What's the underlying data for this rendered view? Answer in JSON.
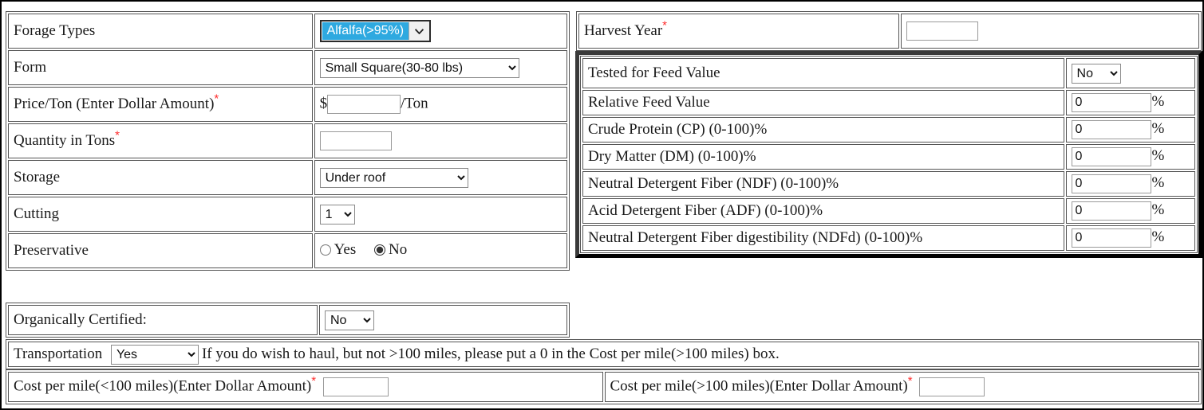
{
  "left_form": {
    "rows": [
      {
        "label": "Forage Types",
        "required": false,
        "control": "select-focused",
        "value": "Alfalfa(>95%)",
        "name": "forage-types"
      },
      {
        "label": "Form",
        "required": false,
        "control": "select",
        "value": "Small Square(30-80 lbs)",
        "name": "form"
      },
      {
        "label": "Price/Ton (Enter Dollar Amount)",
        "required": true,
        "control": "money",
        "prefix": "$",
        "suffix": "/Ton",
        "value": "",
        "name": "price-per-ton"
      },
      {
        "label": "Quantity in Tons",
        "required": true,
        "control": "text",
        "value": "",
        "name": "quantity-in-tons"
      },
      {
        "label": "Storage",
        "required": false,
        "control": "select",
        "value": "Under roof",
        "name": "storage"
      },
      {
        "label": "Cutting",
        "required": false,
        "control": "select",
        "value": "1",
        "name": "cutting"
      },
      {
        "label": "Preservative",
        "required": false,
        "control": "radio",
        "options": [
          "Yes",
          "No"
        ],
        "value": "No",
        "name": "preservative"
      }
    ]
  },
  "organic": {
    "label": "Organically Certified:",
    "value": "No",
    "name": "organically-certified"
  },
  "harvest": {
    "label": "Harvest Year",
    "required": true,
    "value": "",
    "name": "harvest-year"
  },
  "feed_panel": {
    "tested": {
      "label": "Tested for Feed Value",
      "value": "No",
      "name": "tested-for-feed-value"
    },
    "rows": [
      {
        "label": "Relative Feed Value",
        "value": "0",
        "unit": "%",
        "name": "relative-feed-value"
      },
      {
        "label": "Crude Protein (CP) (0-100)%",
        "value": "0",
        "unit": "%",
        "name": "crude-protein"
      },
      {
        "label": "Dry Matter (DM) (0-100)%",
        "value": "0",
        "unit": "%",
        "name": "dry-matter"
      },
      {
        "label": "Neutral Detergent Fiber (NDF) (0-100)%",
        "value": "0",
        "unit": "%",
        "name": "ndf"
      },
      {
        "label": "Acid Detergent Fiber (ADF) (0-100)%",
        "value": "0",
        "unit": "%",
        "name": "adf"
      },
      {
        "label": "Neutral Detergent Fiber digestibility (NDFd) (0-100)%",
        "value": "0",
        "unit": "%",
        "name": "ndfd"
      }
    ]
  },
  "transportation": {
    "label": "Transportation",
    "value": "Yes",
    "note": "If you do wish to haul, but not >100 miles, please put a 0 in the Cost per mile(>100 miles) box."
  },
  "cost": {
    "near": {
      "label": "Cost per mile(<100 miles)(Enter Dollar Amount)",
      "required": true,
      "value": "",
      "name": "cost-per-mile-under-100"
    },
    "far": {
      "label": "Cost per mile(>100 miles)(Enter Dollar Amount)",
      "required": true,
      "value": "",
      "name": "cost-per-mile-over-100"
    }
  },
  "colors": {
    "highlight": "#2ea9e0",
    "required_marker": "#ff2b2b",
    "panel_border": "#3a3a3a"
  },
  "icons": {
    "chevron_down": "chevron-down-icon"
  }
}
